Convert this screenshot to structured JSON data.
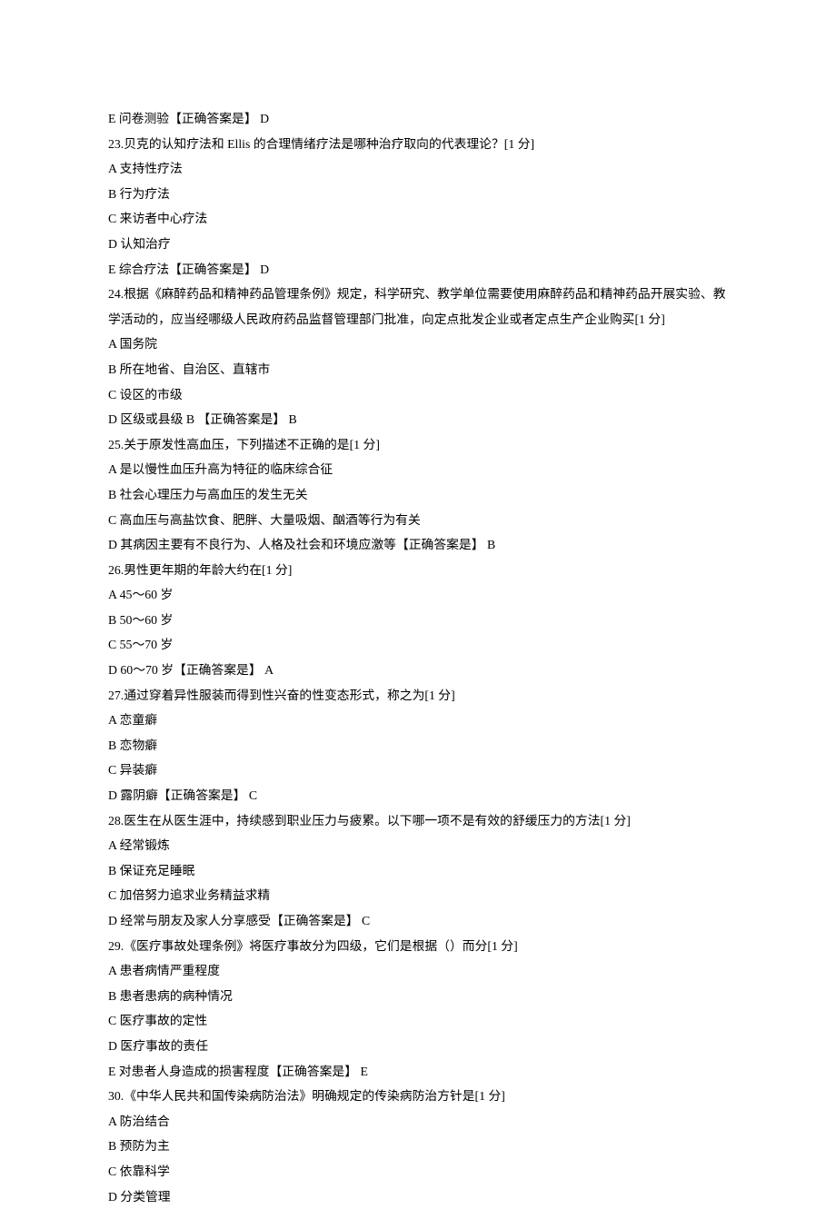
{
  "lines": [
    "E 问卷测验【正确答案是】 D",
    "23.贝克的认知疗法和 Ellis 的合理情绪疗法是哪种治疗取向的代表理论？[1 分]",
    "A 支持性疗法",
    "B 行为疗法",
    "C 来访者中心疗法",
    "D 认知治疗",
    "E 综合疗法【正确答案是】 D",
    "24.根据《麻醉药品和精神药品管理条例》规定，科学研究、教学单位需要使用麻醉药品和精神药品开展实验、教学活动的，应当经哪级人民政府药品监督管理部门批准，向定点批发企业或者定点生产企业购买[1 分]",
    "A 国务院",
    "B 所在地省、自治区、直辖市",
    "C 设区的市级",
    "D 区级或县级 B 【正确答案是】 B",
    "25.关于原发性高血压，下列描述不正确的是[1 分]",
    "A 是以慢性血压升高为特征的临床综合征",
    "B 社会心理压力与高血压的发生无关",
    "C 高血压与高盐饮食、肥胖、大量吸烟、酗酒等行为有关",
    "D 其病因主要有不良行为、人格及社会和环境应激等【正确答案是】 B",
    "26.男性更年期的年龄大约在[1 分]",
    "A 45～60 岁",
    "B 50～60 岁",
    "C 55～70 岁",
    "D 60～70 岁【正确答案是】 A",
    "27.通过穿着异性服装而得到性兴奋的性变态形式，称之为[1 分]",
    "A 恋童癖",
    "B 恋物癖",
    "C 异装癖",
    "D 露阴癖【正确答案是】 C",
    "28.医生在从医生涯中，持续感到职业压力与疲累。以下哪一项不是有效的舒缓压力的方法[1 分]",
    "A 经常锻炼",
    "B 保证充足睡眠",
    "C 加倍努力追求业务精益求精",
    "D 经常与朋友及家人分享感受【正确答案是】 C",
    "29.《医疗事故处理条例》将医疗事故分为四级，它们是根据（）而分[1 分]",
    "A 患者病情严重程度",
    "B 患者患病的病种情况",
    "C 医疗事故的定性",
    "D 医疗事故的责任",
    "E 对患者人身造成的损害程度【正确答案是】 E",
    "30.《中华人民共和国传染病防治法》明确规定的传染病防治方针是[1 分]",
    "A 防治结合",
    "B 预防为主",
    "C 依靠科学",
    "D 分类管理"
  ]
}
